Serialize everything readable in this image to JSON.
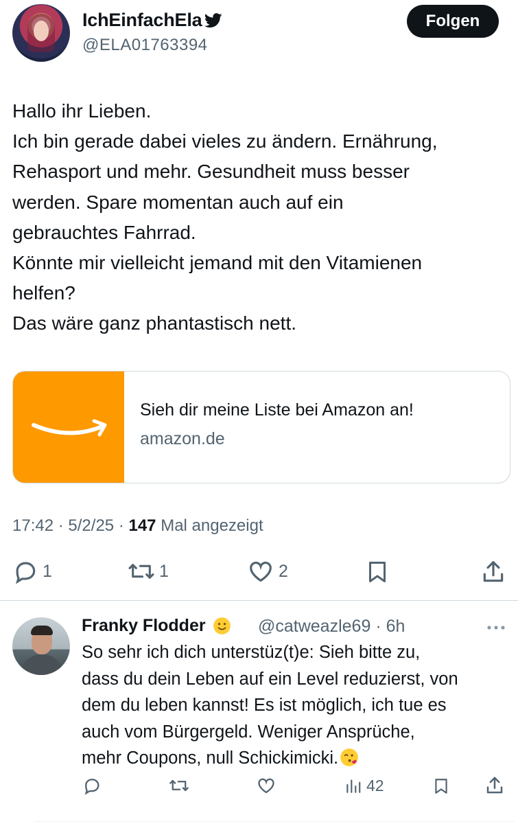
{
  "author": {
    "display_name": "IchEinfachEla",
    "handle": "@ELA01763394",
    "follow_label": "Folgen"
  },
  "tweet": {
    "lines": [
      "Hallo ihr Lieben.",
      "Ich bin gerade dabei vieles zu ändern. Ernährung,",
      "Rehasport und mehr. Gesundheit muss besser",
      "werden. Spare momentan auch auf ein",
      "gebrauchtes Fahrrad.",
      "Könnte mir vielleicht jemand mit den Vitamienen",
      "helfen?",
      "Das wäre ganz phantastisch nett."
    ],
    "card": {
      "title": "Sieh dir meine Liste bei Amazon an!",
      "domain": "amazon.de",
      "thumb_color": "#ff9900"
    },
    "meta": {
      "time": "17:42",
      "date": "5/2/25",
      "views": "147",
      "views_label": "Mal angezeigt"
    },
    "actions": {
      "replies": "1",
      "reposts": "1",
      "likes": "2"
    }
  },
  "reply": {
    "display_name": "Franky Flodder",
    "handle": "@catweazle69",
    "age": "6h",
    "lines": [
      "So sehr ich dich unterstüz(t)e: Sieh bitte zu,",
      "dass du dein Leben auf ein Level reduzierst, von",
      "dem du leben kannst! Es ist möglich, ich tue es",
      "auch vom Bürgergeld. Weniger Ansprüche,",
      "mehr Coupons, null Schickimicki."
    ],
    "actions": {
      "views": "42"
    }
  },
  "colors": {
    "text": "#0f1419",
    "secondary": "#536471",
    "border": "#cfd9de",
    "button_bg": "#0f1419"
  }
}
